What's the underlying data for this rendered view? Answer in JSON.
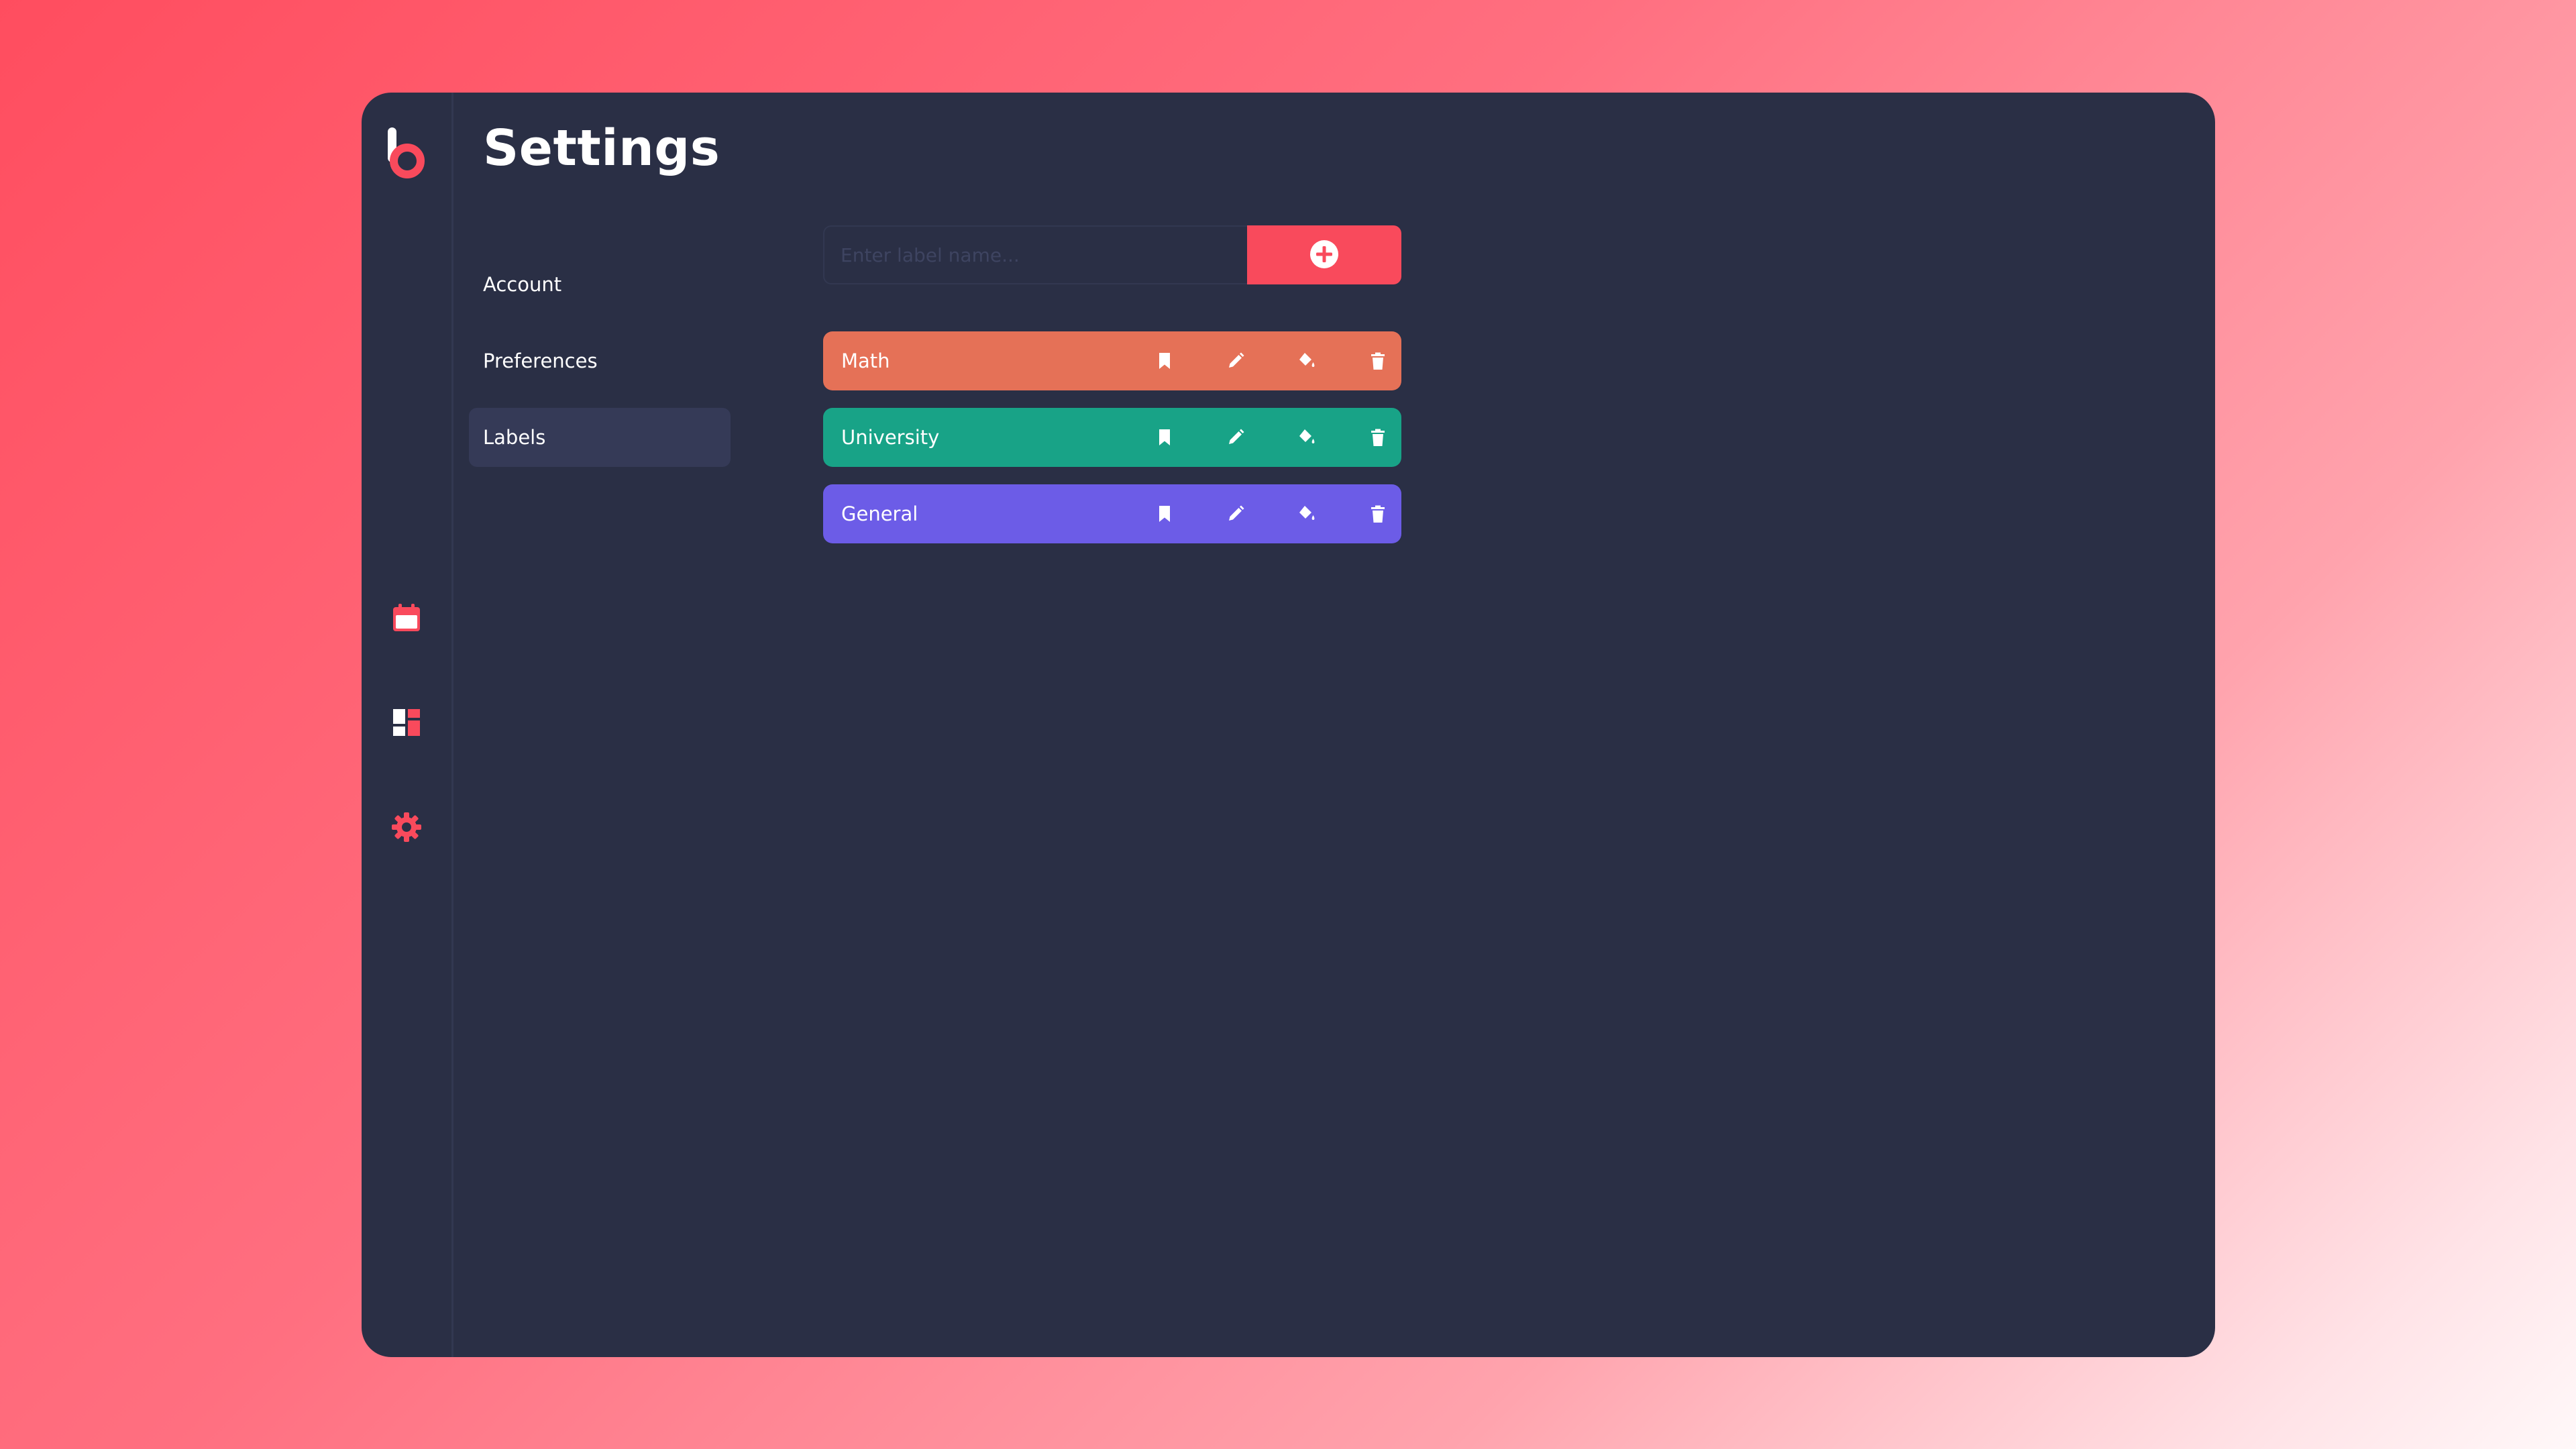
{
  "page": {
    "title": "Settings"
  },
  "nav": {
    "items": [
      {
        "label": "Account",
        "active": false
      },
      {
        "label": "Preferences",
        "active": false
      },
      {
        "label": "Labels",
        "active": true
      }
    ]
  },
  "rail": {
    "icons": [
      "logo-b",
      "calendar-icon",
      "dashboard-icon",
      "gear-icon"
    ],
    "accent": "#f94a5c"
  },
  "add_label": {
    "placeholder": "Enter label name...",
    "button_icon": "plus-circle-icon"
  },
  "labels": [
    {
      "name": "Math",
      "color": "#e57157"
    },
    {
      "name": "University",
      "color": "#18a387"
    },
    {
      "name": "General",
      "color": "#6c5ce7"
    }
  ],
  "label_actions": [
    "bookmark-icon",
    "pencil-icon",
    "paint-bucket-icon",
    "trash-icon"
  ]
}
